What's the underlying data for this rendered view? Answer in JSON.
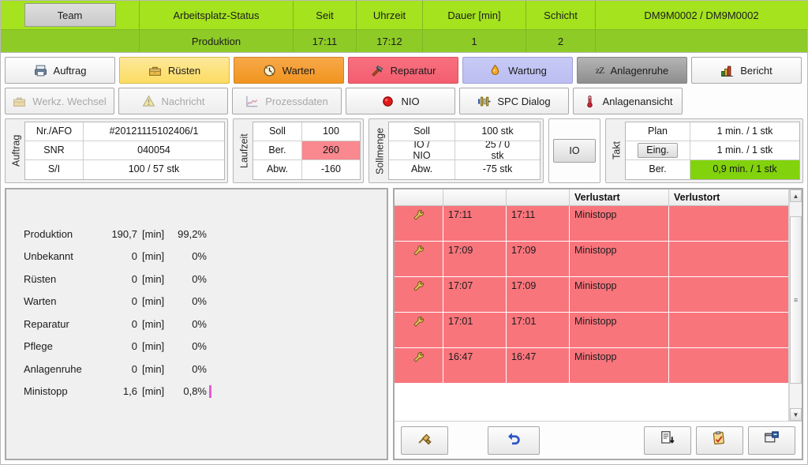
{
  "header": {
    "columns": [
      {
        "label": "Team",
        "value": "",
        "is_button": true
      },
      {
        "label": "Arbeitsplatz-Status",
        "value": "Produktion"
      },
      {
        "label": "Seit",
        "value": "17:11"
      },
      {
        "label": "Uhrzeit",
        "value": "17:12"
      },
      {
        "label": "Dauer [min]",
        "value": "1"
      },
      {
        "label": "Schicht",
        "value": "2"
      },
      {
        "label": "DM9M0002  / DM9M0002",
        "value": ""
      }
    ],
    "accent_color": "#a4e31e",
    "accent_color_dark": "#8ecb27"
  },
  "toolbar_row1": [
    {
      "label": "Auftrag",
      "icon": "printer-icon",
      "style": "white",
      "disabled": false
    },
    {
      "label": "Rüsten",
      "icon": "toolbox-icon",
      "style": "yellow",
      "disabled": false
    },
    {
      "label": "Warten",
      "icon": "clock-gear-icon",
      "style": "orange",
      "disabled": false
    },
    {
      "label": "Reparatur",
      "icon": "hammer-icon",
      "style": "red",
      "disabled": false
    },
    {
      "label": "Wartung",
      "icon": "oil-drop-icon",
      "style": "purple",
      "disabled": false
    },
    {
      "label": "Anlagenruhe",
      "icon": "zzz-icon",
      "style": "grey",
      "disabled": false
    },
    {
      "label": "Bericht",
      "icon": "chart-icon",
      "style": "white",
      "disabled": false
    }
  ],
  "toolbar_row2": [
    {
      "label": "Werkz. Wechsel",
      "icon": "toolbox-icon",
      "style": "white",
      "disabled": true
    },
    {
      "label": "Nachricht",
      "icon": "warning-icon",
      "style": "white",
      "disabled": true
    },
    {
      "label": "Prozessdaten",
      "icon": "line-chart-icon",
      "style": "white",
      "disabled": true
    },
    {
      "label": "NIO",
      "icon": "red-circle-icon",
      "style": "white",
      "disabled": false
    },
    {
      "label": "SPC Dialog",
      "icon": "spc-icon",
      "style": "white",
      "disabled": false
    },
    {
      "label": "Anlagenansicht",
      "icon": "thermometer-icon",
      "style": "white",
      "disabled": false
    }
  ],
  "info": {
    "auftrag": {
      "label": "Auftrag",
      "rows": [
        {
          "key": "Nr./AFO",
          "value": "#20121115102406/1",
          "highlight": "none"
        },
        {
          "key": "SNR",
          "value": "040054",
          "highlight": "none"
        },
        {
          "key": "S/I",
          "value": "100  / 57 stk",
          "highlight": "none"
        }
      ]
    },
    "laufzeit": {
      "label": "Laufzeit",
      "rows": [
        {
          "key": "Soll",
          "value": "100",
          "highlight": "none"
        },
        {
          "key": "Ber.",
          "value": "260",
          "highlight": "red"
        },
        {
          "key": "Abw.",
          "value": "-160",
          "highlight": "none"
        }
      ]
    },
    "sollmenge": {
      "label": "Sollmenge",
      "rows": [
        {
          "key": "Soll",
          "value": "100 stk",
          "highlight": "none"
        },
        {
          "key": "IO /\nNIO",
          "value": "25  / 0\nstk",
          "highlight": "none"
        },
        {
          "key": "Abw.",
          "value": "-75 stk",
          "highlight": "none"
        }
      ]
    },
    "io_button": {
      "label": "IO"
    },
    "takt": {
      "label": "Takt",
      "rows": [
        {
          "key": "Plan",
          "value": "1 min.  / 1 stk",
          "highlight": "none",
          "key_is_button": false
        },
        {
          "key": "Eing.",
          "value": "1 min.  / 1 stk",
          "highlight": "none",
          "key_is_button": true
        },
        {
          "key": "Ber.",
          "value": "0,9 min.  / 1   stk",
          "highlight": "green",
          "key_is_button": false
        }
      ]
    }
  },
  "stats": {
    "unit": "[min]",
    "rows": [
      {
        "name": "Produktion",
        "value": "190,7",
        "unit": "[min]",
        "pct": "99,2%",
        "bar": false
      },
      {
        "name": "Unbekannt",
        "value": "0",
        "unit": "[min]",
        "pct": "0%",
        "bar": false
      },
      {
        "name": "Rüsten",
        "value": "0",
        "unit": "[min]",
        "pct": "0%",
        "bar": false
      },
      {
        "name": "Warten",
        "value": "0",
        "unit": "[min]",
        "pct": "0%",
        "bar": false
      },
      {
        "name": "Reparatur",
        "value": "0",
        "unit": "[min]",
        "pct": "0%",
        "bar": false
      },
      {
        "name": "Pflege",
        "value": "0",
        "unit": "[min]",
        "pct": "0%",
        "bar": false
      },
      {
        "name": "Anlagenruhe",
        "value": "0",
        "unit": "[min]",
        "pct": "0%",
        "bar": false
      },
      {
        "name": "Ministopp",
        "value": "1,6",
        "unit": "[min]",
        "pct": "0,8%",
        "bar": true
      }
    ]
  },
  "losses_table": {
    "headers": [
      "",
      "",
      "",
      "Verlustart",
      "Verlustort"
    ],
    "row_color": "#f9757c",
    "rows": [
      {
        "icon": "wrench-icon",
        "start": "17:11",
        "end": "17:11",
        "verlustart": "Ministopp",
        "verlustort": ""
      },
      {
        "icon": "wrench-icon",
        "start": "17:09",
        "end": "17:09",
        "verlustart": "Ministopp",
        "verlustort": ""
      },
      {
        "icon": "wrench-icon",
        "start": "17:07",
        "end": "17:09",
        "verlustart": "Ministopp",
        "verlustort": ""
      },
      {
        "icon": "wrench-icon",
        "start": "17:01",
        "end": "17:01",
        "verlustart": "Ministopp",
        "verlustort": ""
      },
      {
        "icon": "wrench-icon",
        "start": "16:47",
        "end": "16:47",
        "verlustart": "Ministopp",
        "verlustort": ""
      }
    ],
    "scrollbar": {
      "up_arrow": "▲",
      "down_arrow": "▼",
      "grip": "≡"
    }
  },
  "table_footer_buttons": [
    {
      "icon": "broom-icon",
      "name": "clear-button"
    },
    {
      "icon": "undo-arrow-icon",
      "name": "undo-button"
    },
    {
      "icon": "document-down-icon",
      "name": "export-button"
    },
    {
      "icon": "clipboard-icon",
      "name": "checklist-button"
    },
    {
      "icon": "window-edit-icon",
      "name": "edit-window-button"
    }
  ]
}
